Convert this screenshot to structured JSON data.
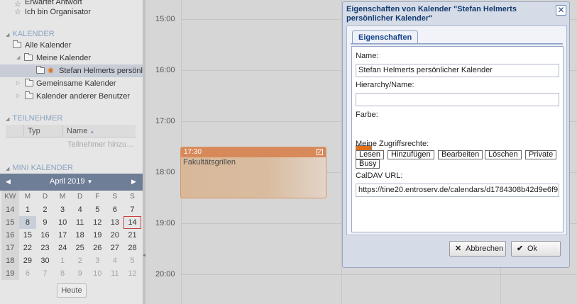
{
  "sidebar": {
    "status_items": [
      {
        "label": "Erwartet Antwort"
      },
      {
        "label": "Ich bin Organisator"
      }
    ],
    "calendar_section": {
      "title": "KALENDER"
    },
    "tree": {
      "all": "Alle Kalender",
      "mine": "Meine Kalender",
      "personal": "Stefan Helmerts persönl",
      "shared": "Gemeinsame Kalender",
      "others": "Kalender anderer Benutzer"
    },
    "participants_section": {
      "title": "TEILNEHMER"
    },
    "participants_grid": {
      "col_type": "Typ",
      "col_name": "Name",
      "add_placeholder": "Teilnehmer hinzu…"
    },
    "mini_calendar_section": {
      "title": "MINI KALENDER"
    },
    "mini_calendar": {
      "month": "April 2019",
      "head": [
        "KW",
        "M",
        "D",
        "M",
        "D",
        "F",
        "S",
        "S"
      ],
      "weeks": [
        [
          "14",
          "1",
          "2",
          "3",
          "4",
          "5",
          "6",
          "7"
        ],
        [
          "15",
          "8",
          "9",
          "10",
          "11",
          "12",
          "13",
          "14"
        ],
        [
          "16",
          "15",
          "16",
          "17",
          "18",
          "19",
          "20",
          "21"
        ],
        [
          "17",
          "22",
          "23",
          "24",
          "25",
          "26",
          "27",
          "28"
        ],
        [
          "18",
          "29",
          "30",
          "1",
          "2",
          "3",
          "4",
          "5"
        ],
        [
          "19",
          "6",
          "7",
          "8",
          "9",
          "10",
          "11",
          "12"
        ]
      ],
      "today_button": "Heute"
    }
  },
  "calendar": {
    "hours": [
      "15:00",
      "16:00",
      "17:00",
      "18:00",
      "19:00",
      "20:00"
    ],
    "event": {
      "time": "17:30",
      "title": "Fakultätsgrillen",
      "color": "#d8895a"
    }
  },
  "dialog": {
    "title": "Eigenschaften von Kalender \"Stefan Helmerts persönlicher Kalender\"",
    "tab": "Eigenschaften",
    "name_label": "Name:",
    "name_value": "Stefan Helmerts persönlicher Kalender",
    "hierarchy_label": "Hierarchy/Name:",
    "hierarchy_value": "",
    "color_label": "Farbe:",
    "color_value": "#e07018",
    "rights_label": "Meine Zugriffsrechte:",
    "rights": [
      "Lesen",
      "Hinzufügen",
      "Bearbeiten",
      "Löschen",
      "Private",
      "Busy"
    ],
    "caldav_label": "CalDAV URL:",
    "caldav_value": "https://tine20.entroserv.de/calendars/d1784308b42d9e6f9",
    "cancel_label": "Abbrechen",
    "ok_label": "Ok"
  }
}
